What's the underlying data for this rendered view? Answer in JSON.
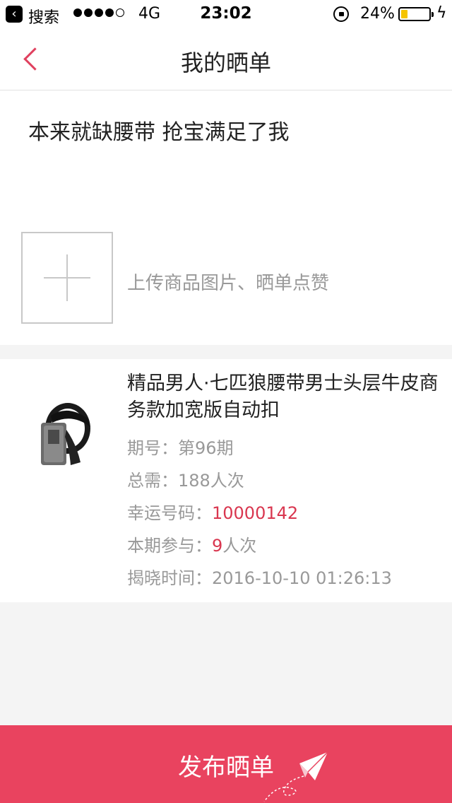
{
  "status_bar": {
    "back_app_label": "搜索",
    "network": "4G",
    "time": "23:02",
    "battery_percent": "24%",
    "battery_level": 0.24,
    "signal_bars_filled": 4,
    "signal_bars_total": 5
  },
  "nav": {
    "title": "我的晒单"
  },
  "post": {
    "text": "本来就缺腰带  抢宝满足了我",
    "upload_hint": "上传商品图片、晒单点赞"
  },
  "product": {
    "title": "精品男人·七匹狼腰带男士头层牛皮商务款加宽版自动扣",
    "period_label": "期号：",
    "period_value": "第96期",
    "total_label": "总需：",
    "total_value": "188人次",
    "lucky_label": "幸运号码：",
    "lucky_value": "10000142",
    "joined_label": "本期参与：",
    "joined_value": "9",
    "joined_unit": "人次",
    "reveal_label": "揭晓时间：",
    "reveal_value": "2016-10-10 01:26:13"
  },
  "publish": {
    "label": "发布晒单"
  },
  "colors": {
    "accent": "#e9435f",
    "highlight_text": "#d9364f",
    "battery_fill": "#f5c400"
  },
  "icons": {
    "back": "chevron-left-icon",
    "upload": "plus-icon",
    "publish": "paper-plane-icon"
  }
}
